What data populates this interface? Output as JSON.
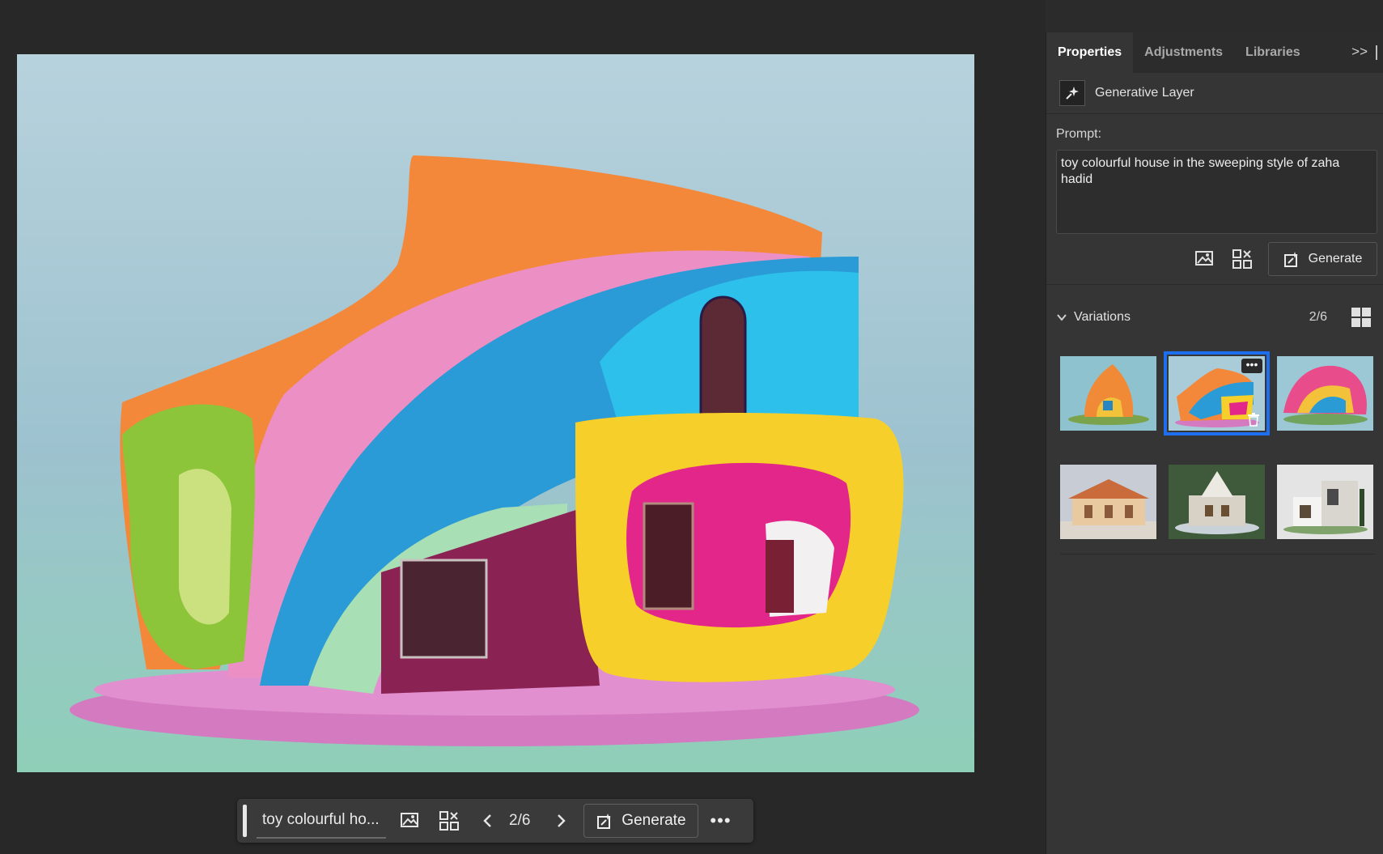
{
  "panel": {
    "tabs": [
      "Properties",
      "Adjustments",
      "Libraries"
    ],
    "collapse_label": ">>",
    "layer_name": "Generative Layer",
    "prompt_label": "Prompt:",
    "prompt_text": "toy colourful house in the sweeping style of zaha hadid",
    "generate_label": "Generate",
    "variations_title": "Variations",
    "variations_count": "2/6",
    "more_label": "•••"
  },
  "taskbar": {
    "prompt_text": "toy colourful ho...",
    "counter": "2/6",
    "generate_label": "Generate",
    "more_label": "•••"
  },
  "variations": {
    "selected_index": 1,
    "items": [
      "variation-1",
      "variation-2",
      "variation-3",
      "variation-4",
      "variation-5",
      "variation-6"
    ]
  },
  "colors": {
    "accent": "#1e6ff0",
    "panel_bg": "#353535",
    "canvas_bg": "#282828"
  }
}
